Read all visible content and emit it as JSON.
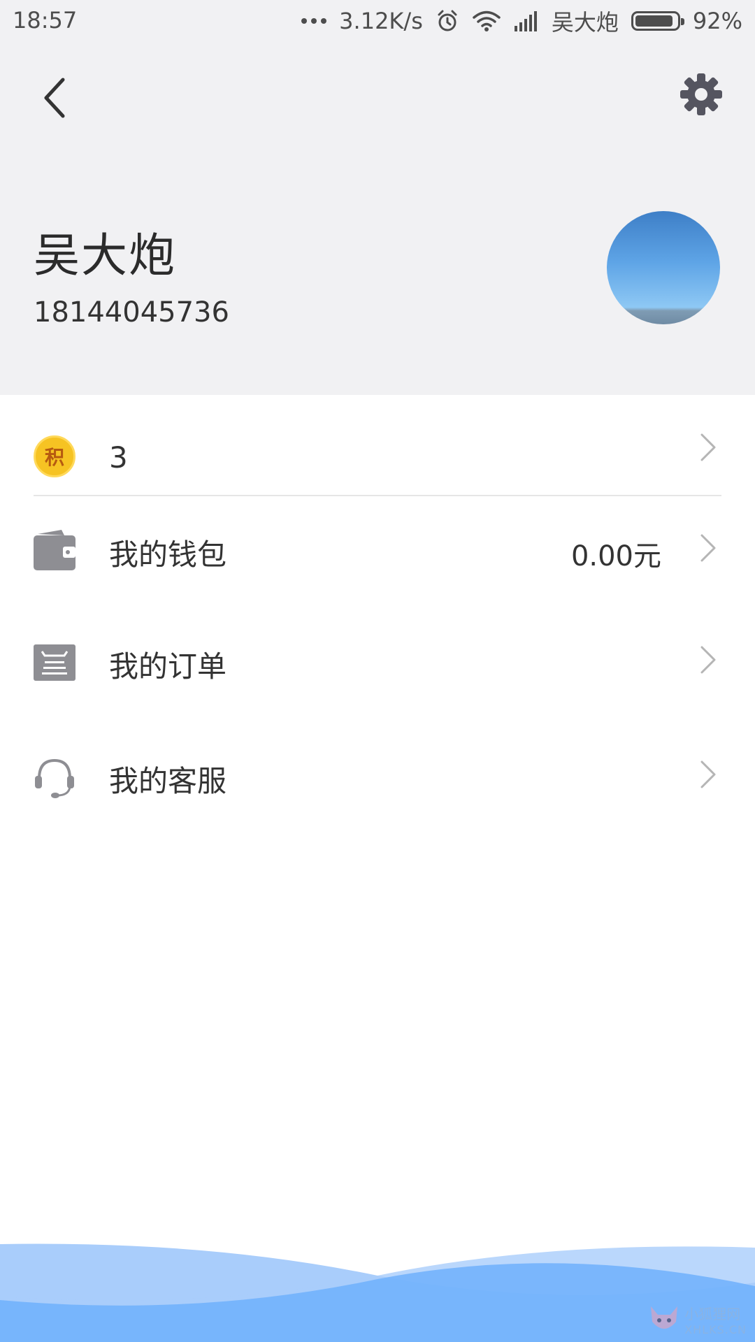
{
  "status_bar": {
    "time": "18:57",
    "net_speed": "3.12K/s",
    "carrier": "吴大炮",
    "battery": "92%",
    "battery_level": 0.92
  },
  "header": {
    "back_icon": "back-arrow-icon",
    "settings_icon": "gear-icon"
  },
  "profile": {
    "name": "吴大炮",
    "phone": "18144045736"
  },
  "menu": {
    "points": {
      "icon_text": "积",
      "value": "3"
    },
    "wallet": {
      "label": "我的钱包",
      "value": "0.00元",
      "icon": "wallet-icon"
    },
    "orders": {
      "label": "我的订单",
      "icon": "order-list-icon"
    },
    "service": {
      "label": "我的客服",
      "icon": "headset-icon"
    }
  },
  "watermark": {
    "cn": "小狐狸网",
    "en": "XHLKS.CN"
  },
  "colors": {
    "header_bg": "#f1f1f3",
    "icon_gray": "#8e8e93",
    "wave_light": "#a9cdfb",
    "wave_dark": "#6fb0fb",
    "coin": "#f6c323"
  }
}
